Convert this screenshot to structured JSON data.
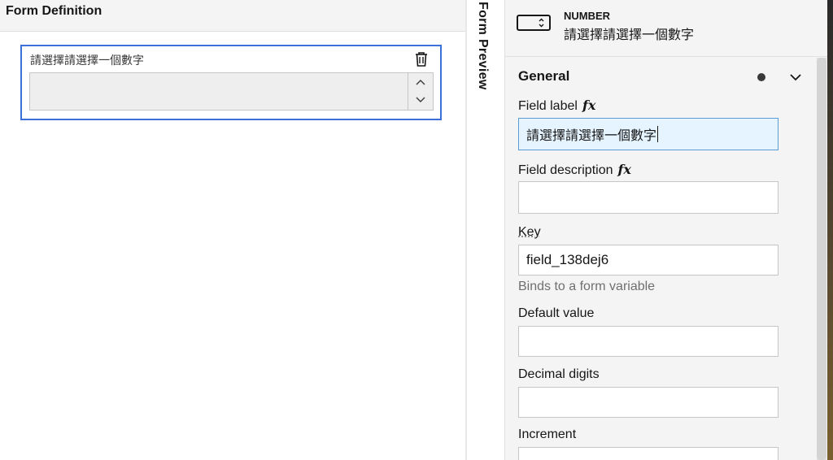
{
  "form_definition": {
    "title": "Form Definition",
    "field": {
      "label": "請選擇請選擇一個數字",
      "value": ""
    }
  },
  "form_preview": {
    "label": "Form Preview"
  },
  "properties": {
    "type": "NUMBER",
    "name": "請選擇請選擇一個數字",
    "group": {
      "title": "General"
    },
    "fx_symbol": "fx",
    "field_label": {
      "label": "Field label",
      "value": "請選擇請選擇一個數字"
    },
    "field_description": {
      "label": "Field description",
      "value": ""
    },
    "key": {
      "label": "Key",
      "value": "field_138dej6",
      "helper": "Binds to a form variable"
    },
    "default_value": {
      "label": "Default value",
      "value": ""
    },
    "decimal_digits": {
      "label": "Decimal digits",
      "value": ""
    },
    "increment": {
      "label": "Increment",
      "value": ""
    }
  },
  "icons": [
    "trash-icon",
    "chevron-up-icon",
    "chevron-down-icon",
    "number-field-icon",
    "collapse-chevron-icon",
    "fx-icon"
  ]
}
